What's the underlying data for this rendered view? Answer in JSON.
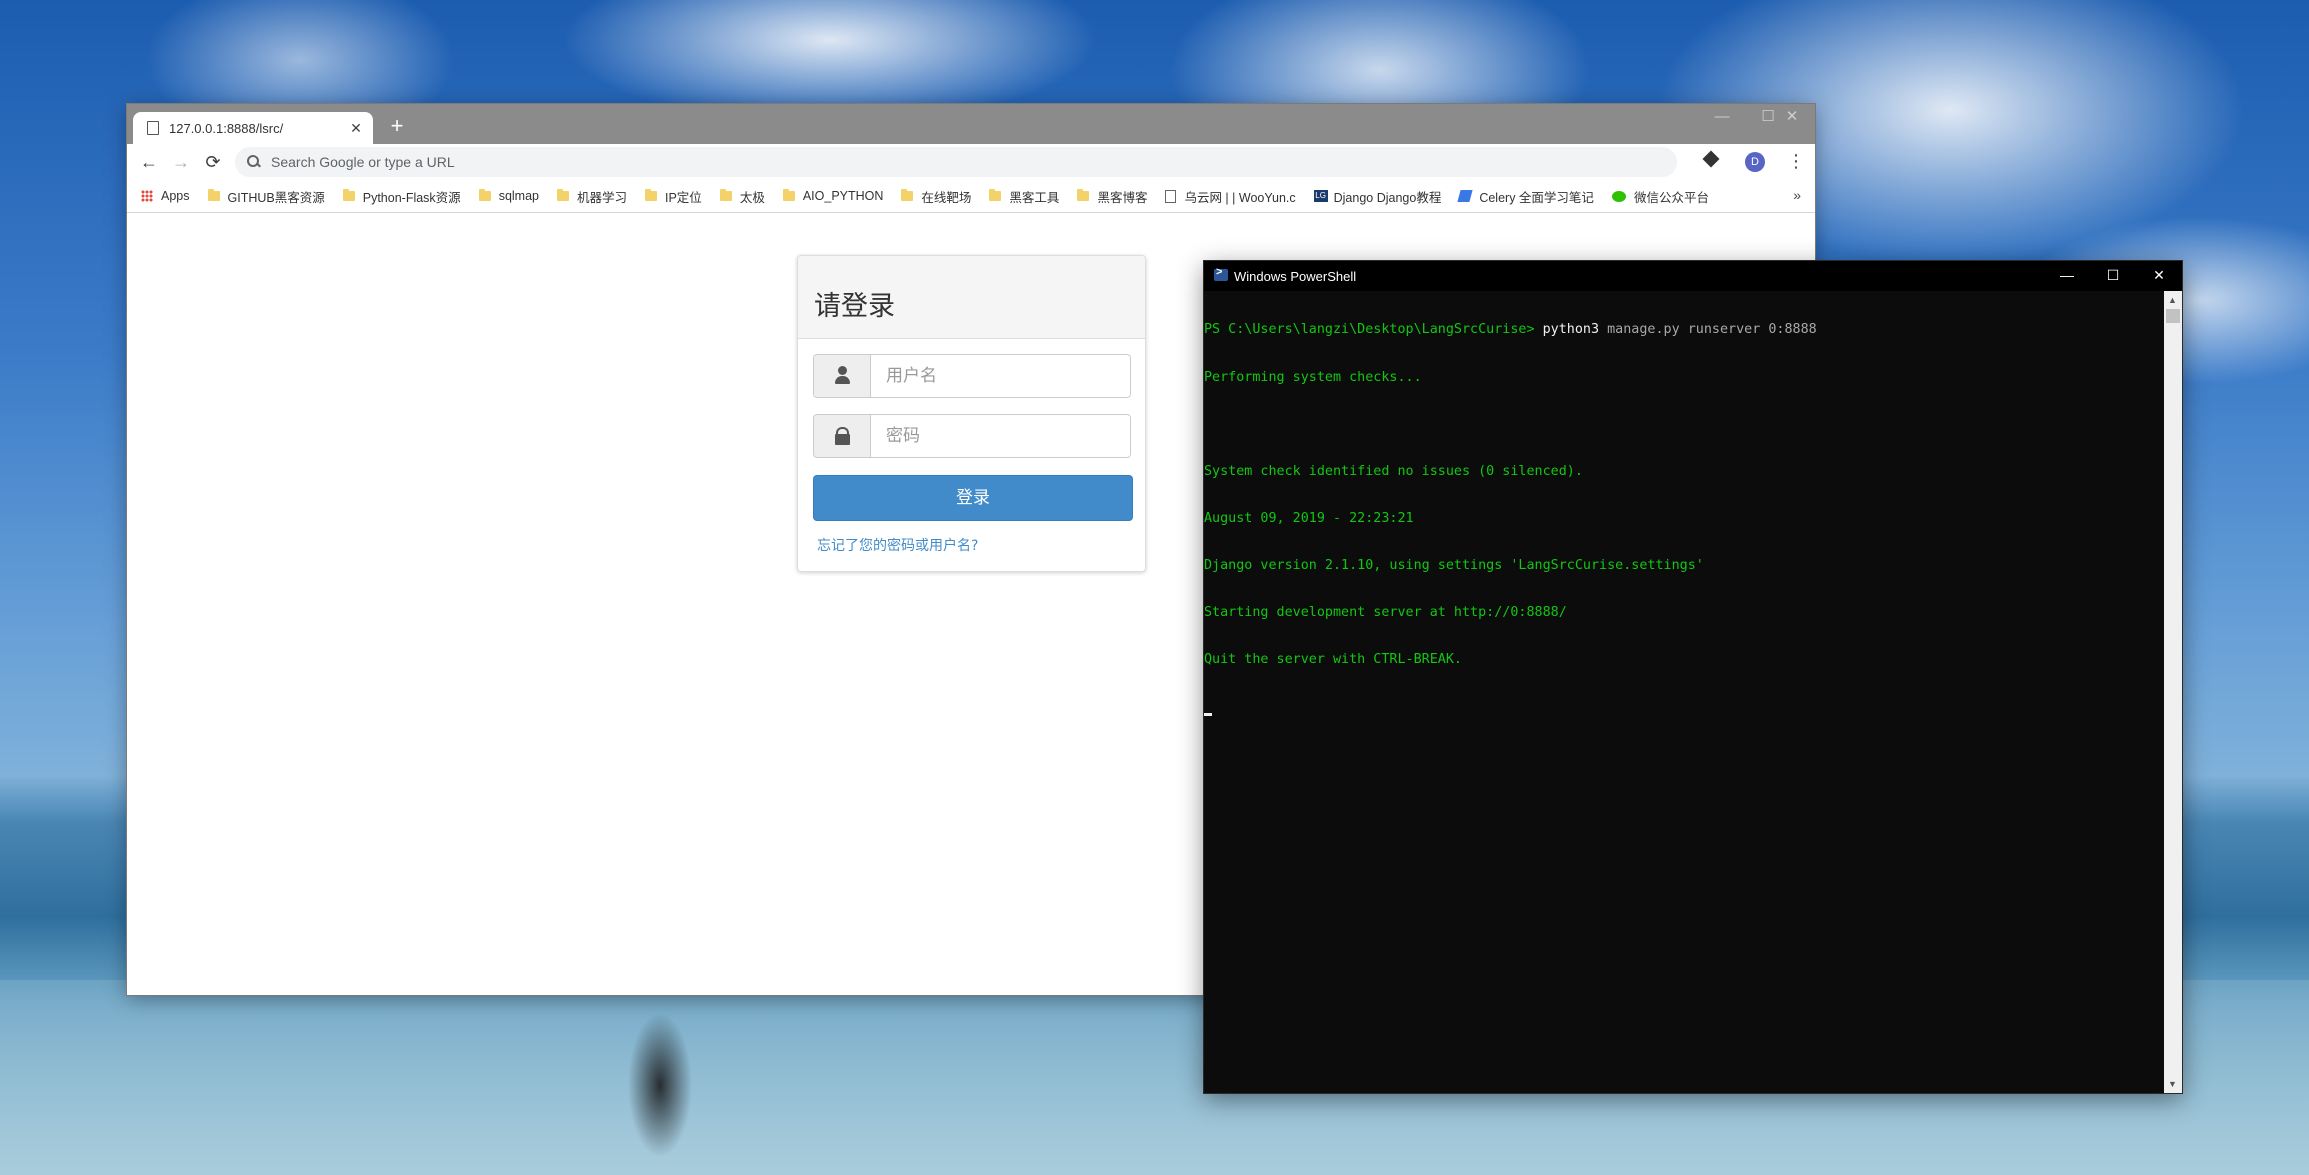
{
  "browser": {
    "tab_title": "127.0.0.1:8888/lsrc/",
    "tab_close": "✕",
    "new_tab": "+",
    "window_controls": {
      "minimize": "—",
      "maximize": "☐",
      "close": "✕"
    },
    "nav": {
      "back": "←",
      "forward": "→",
      "reload": "⟳"
    },
    "omnibox_placeholder": "Search Google or type a URL",
    "avatar_letter": "D",
    "menu": "⋮",
    "bookmarks_more": "»",
    "bookmarks": [
      {
        "label": "Apps",
        "icon": "apps-grid-icon"
      },
      {
        "label": "GITHUB黑客资源",
        "icon": "folder-icon"
      },
      {
        "label": "Python-Flask资源",
        "icon": "folder-icon"
      },
      {
        "label": "sqlmap",
        "icon": "folder-icon"
      },
      {
        "label": "机器学习",
        "icon": "folder-icon"
      },
      {
        "label": "IP定位",
        "icon": "folder-icon"
      },
      {
        "label": "太极",
        "icon": "folder-icon"
      },
      {
        "label": "AIO_PYTHON",
        "icon": "folder-icon"
      },
      {
        "label": "在线靶场",
        "icon": "folder-icon"
      },
      {
        "label": "黑客工具",
        "icon": "folder-icon"
      },
      {
        "label": "黑客博客",
        "icon": "folder-icon"
      },
      {
        "label": "乌云网 | | WooYun.c",
        "icon": "document-icon"
      },
      {
        "label": "Django Django教程",
        "icon": "lg-icon"
      },
      {
        "label": "Celery 全面学习笔记",
        "icon": "celery-icon"
      },
      {
        "label": "微信公众平台",
        "icon": "wechat-icon"
      }
    ]
  },
  "login": {
    "title": "请登录",
    "username_placeholder": "用户名",
    "password_placeholder": "密码",
    "submit_label": "登录",
    "forgot_link": "忘记了您的密码或用户名?"
  },
  "powershell": {
    "title": "Windows PowerShell",
    "window_controls": {
      "minimize": "—",
      "maximize": "☐",
      "close": "✕"
    },
    "prompt": "PS C:\\Users\\langzi\\Desktop\\LangSrcCurise> ",
    "command": "python3",
    "args": " manage.py runserver 0:8888",
    "output": [
      "Performing system checks...",
      "",
      "System check identified no issues (0 silenced).",
      "August 09, 2019 - 22:23:21",
      "Django version 2.1.10, using settings 'LangSrcCurise.settings'",
      "Starting development server at http://0:8888/",
      "Quit the server with CTRL-BREAK."
    ],
    "scroll_up": "▲",
    "scroll_down": "▼"
  },
  "colors": {
    "terminal_green": "#13c613",
    "terminal_bg": "#0c0c0c",
    "primary_button": "#428bca",
    "chrome_titlebar": "#8b8b8b"
  }
}
